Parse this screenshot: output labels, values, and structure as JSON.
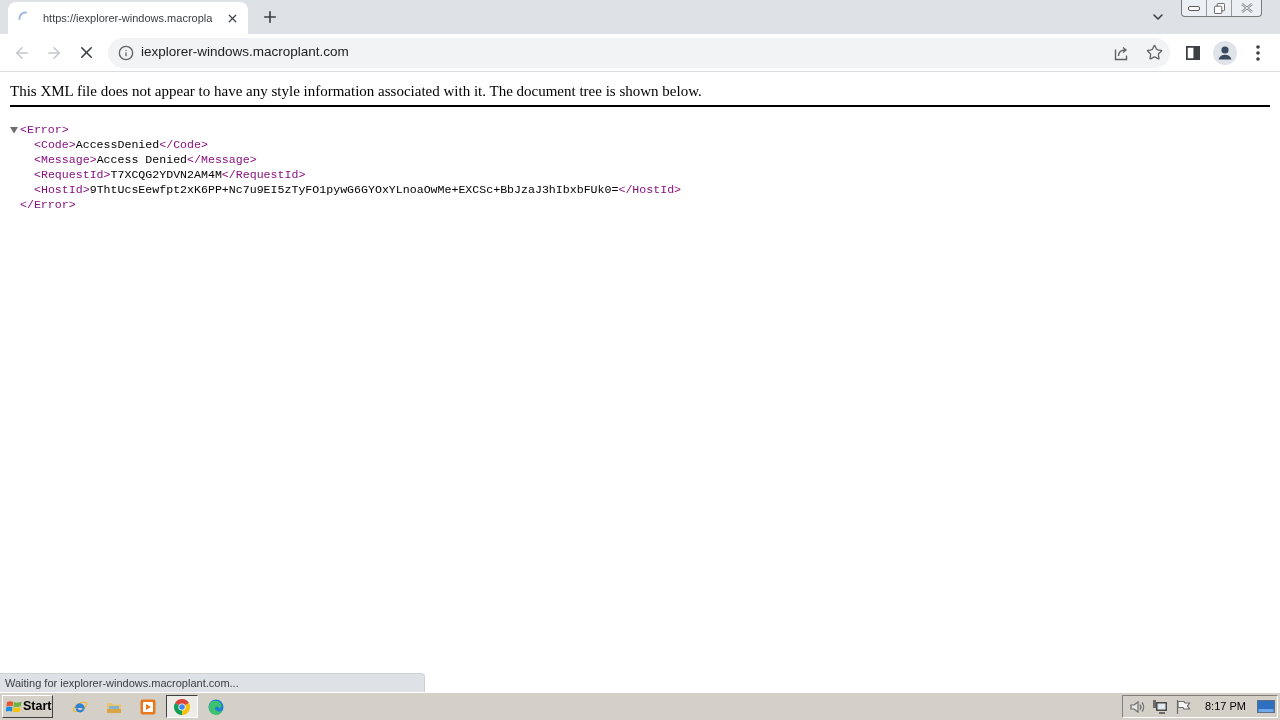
{
  "tab_strip": {
    "tabs": [
      {
        "title": "https://iexplorer-windows.macropla",
        "selected": true,
        "loading": true
      }
    ]
  },
  "toolbar": {
    "nav_buttons": [
      {
        "kind": "back",
        "disabled": true
      },
      {
        "kind": "forward",
        "disabled": true
      },
      {
        "kind": "stop",
        "disabled": false
      }
    ],
    "address": "iexplorer-windows.macroplant.com"
  },
  "page": {
    "notice": "This XML file does not appear to have any style information associated with it. The document tree is shown below.",
    "xml_tree": {
      "open": "<Error>",
      "close": "</Error>",
      "expanded": true,
      "children": [
        {
          "open": "<Code>",
          "text": "AccessDenied",
          "close": "</Code>"
        },
        {
          "open": "<Message>",
          "text": "Access Denied",
          "close": "</Message>"
        },
        {
          "open": "<RequestId>",
          "text": "T7XCQG2YDVN2AM4M",
          "close": "</RequestId>"
        },
        {
          "open": "<HostId>",
          "text": "9ThtUcsEewfpt2xK6PP+Nc7u9EI5zTyFO1pywG6GYOxYLnoaOwMe+EXCSc+BbJzaJ3hIbxbFUk0=",
          "close": "</HostId>"
        }
      ]
    }
  },
  "status_bubble": "Waiting for iexplorer-windows.macroplant.com...",
  "taskbar": {
    "start_label": "Start",
    "apps": [
      {
        "kind": "e_browser",
        "selected": false
      },
      {
        "kind": "folder",
        "selected": false
      },
      {
        "kind": "player",
        "selected": false
      },
      {
        "kind": "round_browser",
        "selected": true
      },
      {
        "kind": "wave_browser",
        "selected": false
      }
    ],
    "tray_icons": [
      {
        "kind": "speaker"
      },
      {
        "kind": "network"
      },
      {
        "kind": "flag"
      }
    ],
    "clock": "8:17 PM"
  }
}
